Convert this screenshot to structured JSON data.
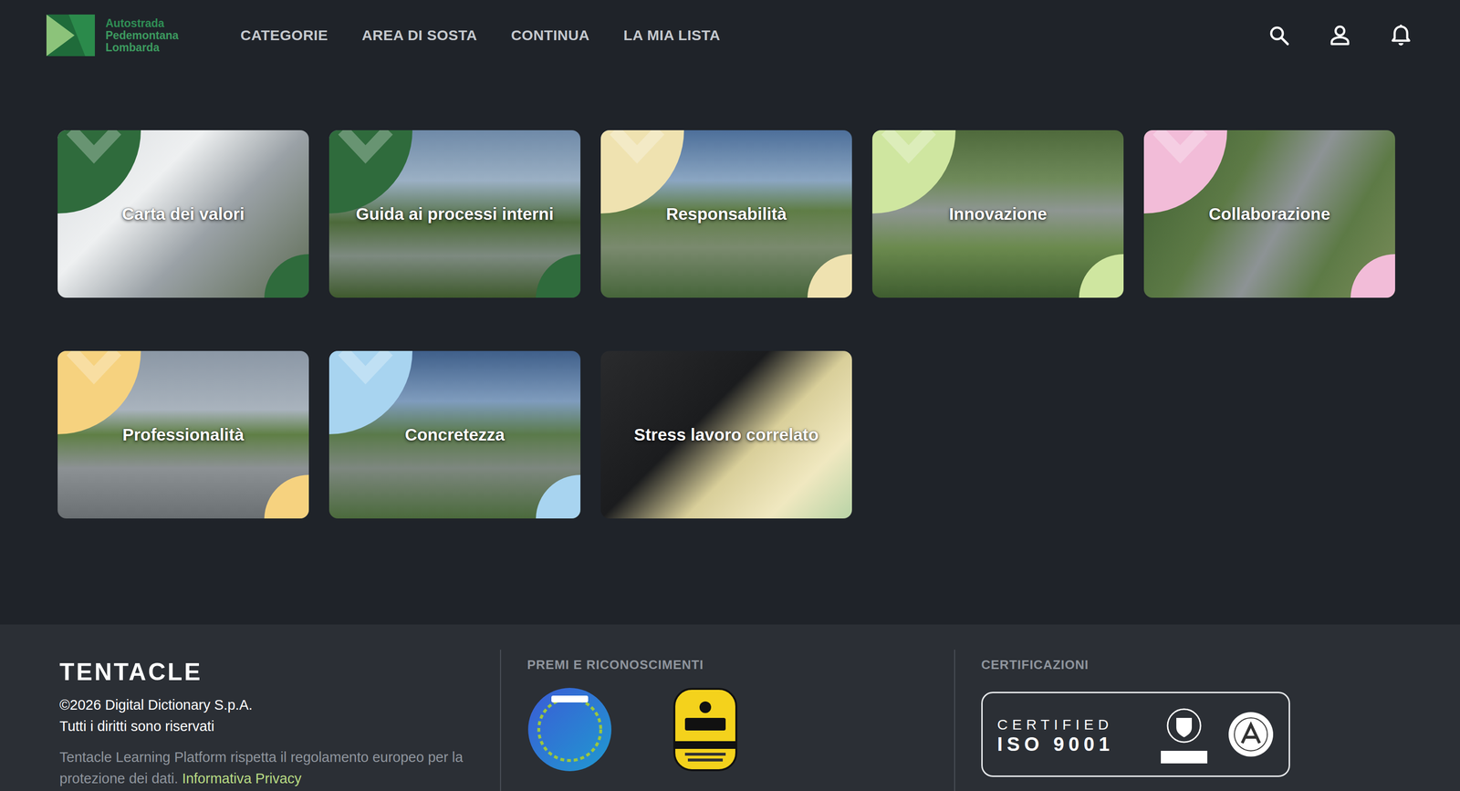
{
  "header": {
    "logo": [
      "Autostrada",
      "Pedemontana",
      "Lombarda"
    ],
    "nav": [
      {
        "label": "CATEGORIE"
      },
      {
        "label": "AREA DI SOSTA"
      },
      {
        "label": "CONTINUA"
      },
      {
        "label": "LA MIA LISTA"
      }
    ]
  },
  "categories": [
    {
      "title": "Carta dei valori",
      "kind": "decorated",
      "color": "#2f6b3c"
    },
    {
      "title": "Guida ai processi interni",
      "kind": "decorated",
      "color": "#2f6b3c"
    },
    {
      "title": "Responsabilità",
      "kind": "decorated",
      "color": "#efe2b0"
    },
    {
      "title": "Innovazione",
      "kind": "decorated",
      "color": "#cfe6a0"
    },
    {
      "title": "Collaborazione",
      "kind": "decorated",
      "color": "#f2bcd8"
    },
    {
      "title": "Professionalità",
      "kind": "decorated",
      "color": "#f6d27f"
    },
    {
      "title": "Concretezza",
      "kind": "decorated",
      "color": "#a8d4f0"
    },
    {
      "title": "Stress lavoro correlato",
      "kind": "plain"
    }
  ],
  "footer": {
    "brand": "TENTACLE",
    "copyright": "©2026 Digital Dictionary S.p.A.",
    "rights": "Tutti i diritti sono riservati",
    "privacy_text": "Tentacle Learning Platform rispetta il regolamento europeo per la protezione dei dati.",
    "privacy_link": "Informativa Privacy",
    "awards_title": "PREMI E RICONOSCIMENTI",
    "certifications_title": "CERTIFICAZIONI",
    "certification": [
      "CERTIFIED",
      "ISO 9001"
    ]
  }
}
